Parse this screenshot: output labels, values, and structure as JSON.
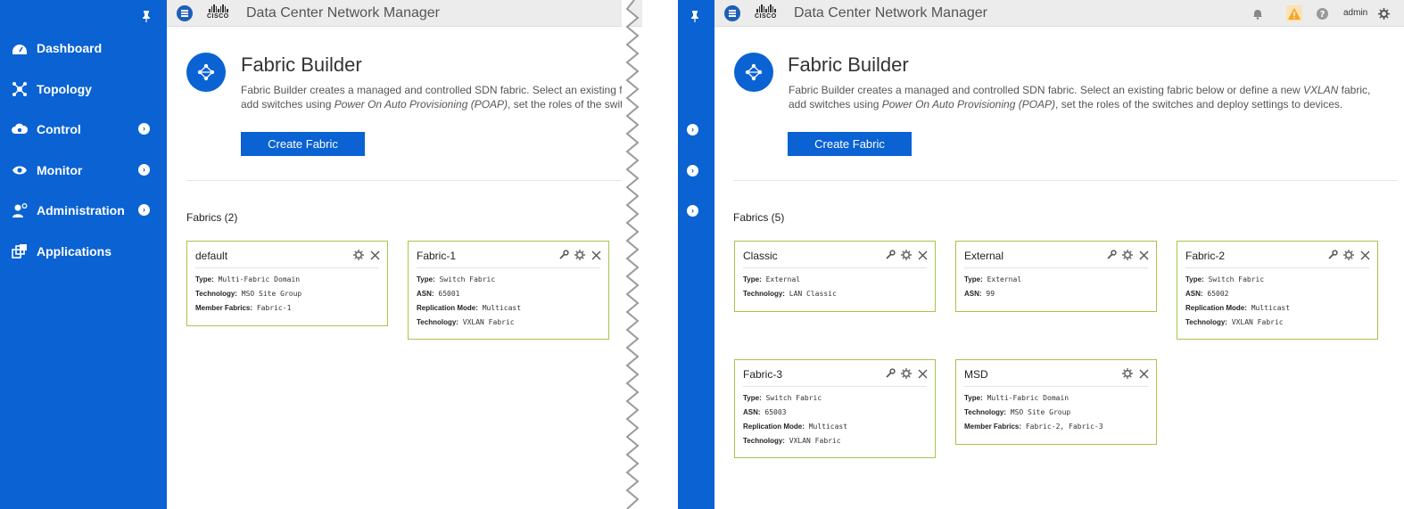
{
  "app_title": "Data Center Network Manager",
  "cisco_word": "CISCO",
  "user": "admin",
  "sidebar": {
    "items": [
      {
        "label": "Dashboard",
        "icon": "dashboard-icon",
        "has_submenu": false
      },
      {
        "label": "Topology",
        "icon": "topology-icon",
        "has_submenu": false
      },
      {
        "label": "Control",
        "icon": "control-icon",
        "has_submenu": true
      },
      {
        "label": "Monitor",
        "icon": "eye-icon",
        "has_submenu": true
      },
      {
        "label": "Administration",
        "icon": "admin-user-icon",
        "has_submenu": true
      },
      {
        "label": "Applications",
        "icon": "applications-icon",
        "has_submenu": false
      }
    ]
  },
  "page": {
    "title": "Fabric Builder",
    "desc_left": {
      "line1": "Fabric Builder creates a managed and controlled SDN fabric. Select an existing fabric",
      "line2_pre": "add switches using ",
      "line2_em": "Power On Auto Provisioning (POAP)",
      "line2_post": ", set the roles of the switch"
    },
    "desc_right": {
      "line1_pre": "Fabric Builder creates a managed and controlled SDN fabric. Select an existing fabric below or define a new ",
      "line1_em": "VXLAN",
      "line1_post": " fabric,",
      "line2_pre": "add switches using ",
      "line2_em": "Power On Auto Provisioning (POAP)",
      "line2_post": ", set the roles of the switches and deploy settings to devices."
    },
    "create_button": "Create Fabric"
  },
  "left": {
    "fabrics_heading": "Fabrics (2)",
    "cards": [
      {
        "title": "default",
        "wrench": false,
        "rows": [
          [
            "Type:",
            " Multi-Fabric Domain"
          ],
          [
            "Technology:",
            " MSO Site Group"
          ],
          [
            "Member Fabrics:",
            " Fabric-1"
          ]
        ]
      },
      {
        "title": "Fabric-1",
        "wrench": true,
        "rows": [
          [
            "Type:",
            " Switch Fabric"
          ],
          [
            "ASN:",
            " 65001"
          ],
          [
            "Replication Mode:",
            " Multicast"
          ],
          [
            "Technology:",
            " VXLAN Fabric"
          ]
        ]
      }
    ]
  },
  "right": {
    "fabrics_heading": "Fabrics (5)",
    "cards": [
      {
        "title": "Classic",
        "wrench": true,
        "rows": [
          [
            "Type:",
            " External"
          ],
          [
            "Technology:",
            " LAN Classic"
          ]
        ]
      },
      {
        "title": "External",
        "wrench": true,
        "rows": [
          [
            "Type:",
            " External"
          ],
          [
            "ASN:",
            " 99"
          ]
        ]
      },
      {
        "title": "Fabric-2",
        "wrench": true,
        "rows": [
          [
            "Type:",
            " Switch Fabric"
          ],
          [
            "ASN:",
            " 65002"
          ],
          [
            "Replication Mode:",
            " Multicast"
          ],
          [
            "Technology:",
            " VXLAN Fabric"
          ]
        ]
      },
      {
        "title": "Fabric-3",
        "wrench": true,
        "rows": [
          [
            "Type:",
            " Switch Fabric"
          ],
          [
            "ASN:",
            " 65003"
          ],
          [
            "Replication Mode:",
            " Multicast"
          ],
          [
            "Technology:",
            " VXLAN Fabric"
          ]
        ]
      },
      {
        "title": "MSD",
        "wrench": false,
        "rows": [
          [
            "Type:",
            " Multi-Fabric Domain"
          ],
          [
            "Technology:",
            " MSO Site Group"
          ],
          [
            "Member Fabrics:",
            " Fabric-2, Fabric-3"
          ]
        ]
      }
    ]
  },
  "colors": {
    "brand_blue": "#0a62d3",
    "card_border": "#a4c64a",
    "warning": "#f5a623"
  }
}
